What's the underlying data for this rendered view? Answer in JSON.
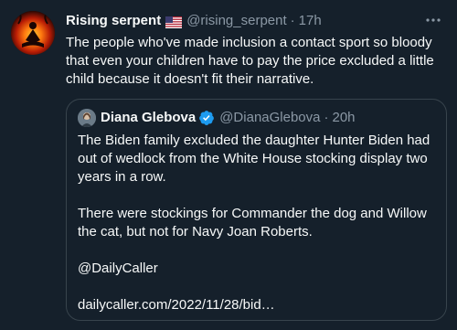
{
  "tweet": {
    "author_name": "Rising serpent",
    "author_handle": "@rising_serpent",
    "separator": "·",
    "time": "17h",
    "flag_icon": "us-flag-icon",
    "more_icon": "more-icon",
    "text": "The people who've made inclusion a contact sport so bloody that even your children have to pay the price excluded a little child because it doesn't fit their narrative."
  },
  "quoted": {
    "author_name": "Diana Glebova",
    "author_handle": "@DianaGlebova",
    "separator": "·",
    "time": "20h",
    "verified_icon": "verified-badge-icon",
    "paragraphs": [
      "The Biden family excluded the daughter Hunter Biden had out of wedlock from the White House stocking display two years in a row.",
      "There were stockings for Commander the dog and Willow the cat, but not for Navy Joan Roberts.",
      "@DailyCaller",
      "dailycaller.com/2022/11/28/bid…"
    ]
  },
  "colors": {
    "background": "#15202b",
    "text": "#f7f9f9",
    "secondary": "#8b98a5",
    "border": "#38444d",
    "verified": "#1d9bf0"
  }
}
